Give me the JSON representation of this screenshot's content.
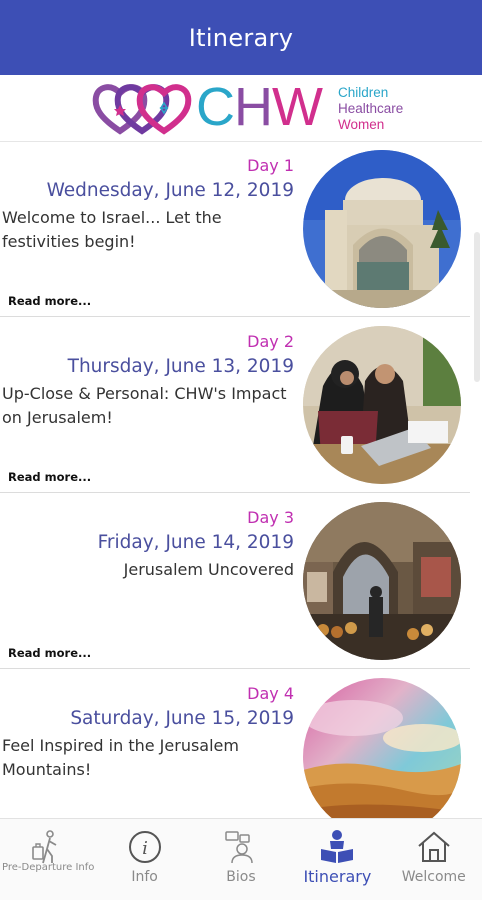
{
  "header": {
    "title": "Itinerary"
  },
  "logo": {
    "letters": [
      "C",
      "H",
      "W"
    ],
    "subtitle": [
      "Children",
      "Healthcare",
      "Women"
    ]
  },
  "days": [
    {
      "day": "Day 1",
      "date": "Wednesday, June 12, 2019",
      "desc": "Welcome to Israel... Let the festivities begin!",
      "align": "left",
      "read_more": "Read more...",
      "photo": "synagogue-dome-photo"
    },
    {
      "day": "Day 2",
      "date": "Thursday, June 13, 2019",
      "desc": "Up-Close & Personal: CHW's Impact on Jerusalem!",
      "align": "left",
      "read_more": "Read more...",
      "photo": "students-laptop-photo"
    },
    {
      "day": "Day 3",
      "date": "Friday, June 14, 2019",
      "desc": "Jerusalem Uncovered",
      "align": "right",
      "read_more": "Read more...",
      "photo": "market-street-photo"
    },
    {
      "day": "Day 4",
      "date": "Saturday, June 15, 2019",
      "desc": "Feel Inspired in the Jerusalem Mountains!",
      "align": "left",
      "read_more": "",
      "photo": "desert-sky-photo"
    }
  ],
  "tabs": [
    {
      "label": "Pre-Departure Info",
      "icon": "traveler-icon",
      "active": false
    },
    {
      "label": "Info",
      "icon": "info-circle-icon",
      "active": false
    },
    {
      "label": "Bios",
      "icon": "bios-chat-icon",
      "active": false
    },
    {
      "label": "Itinerary",
      "icon": "itinerary-book-icon",
      "active": true
    },
    {
      "label": "Welcome",
      "icon": "home-icon",
      "active": false
    }
  ],
  "colors": {
    "header": "#3d4fb5",
    "day_label": "#c02fb1",
    "date": "#4a4f9e",
    "tab_active": "#3d4fb5",
    "tab_inactive": "#8a8a8a"
  }
}
